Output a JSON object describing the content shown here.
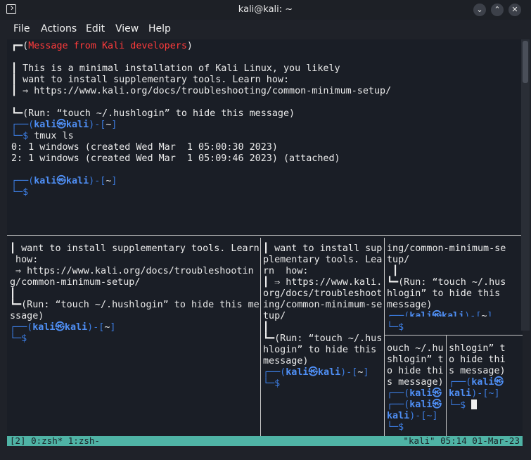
{
  "window": {
    "title": "kali@kali: ~",
    "buttons": [
      "⌄",
      "⌃",
      "✕"
    ]
  },
  "menu": [
    "File",
    "Actions",
    "Edit",
    "View",
    "Help"
  ],
  "main_pane": {
    "banner": {
      "header_prefix": "┏━(",
      "header_text": "Message from Kali developers",
      "header_suffix": ")",
      "line1": "┃ This is a minimal installation of Kali Linux, you likely",
      "line2": "┃ want to install supplementary tools. Learn how:",
      "line3": "┃ ⇒ https://www.kali.org/docs/troubleshooting/common-minimum-setup/",
      "footer": "┗━(Run: “touch ~/.hushlogin” to hide this message)"
    },
    "prompt_top_a": "┌──(",
    "prompt_user": "kali㉿kali",
    "prompt_top_b": ")-[",
    "prompt_dir": "~",
    "prompt_top_c": "]",
    "prompt_bottom": "└─$",
    "command": "tmux ls",
    "output1": "0: 1 windows (created Wed Mar  1 05:00:30 2023)",
    "output2": "2: 1 windows (created Wed Mar  1 05:09:46 2023) (attached)"
  },
  "pane_left": {
    "lines": [
      "┃ want to install supplementary tools. Learn",
      " how:",
      " ⇒ https://www.kali.org/docs/troubleshootin",
      "g/common-minimum-setup/",
      "┃",
      "┗━(Run: “touch ~/.hushlogin” to hide this me",
      "ssage)"
    ]
  },
  "pane_mid": {
    "lines": [
      "┃ want to install sup",
      "plementary tools. Lea",
      "rn  how:",
      "┃ ⇒ https://www.kali.",
      "org/docs/troubleshoot",
      "ing/common-minimum-se",
      "tup/",
      "┃",
      "┗━(Run: “touch ~/.hus",
      "hlogin” to hide this",
      "message)"
    ]
  },
  "pane_rt": {
    "lines": [
      "ing/common-minimum-se",
      "tup/",
      " ┃",
      "┗━(Run: “touch ~/.hus",
      "hlogin” to hide this",
      "message)"
    ]
  },
  "pane_rb1": {
    "lines": [
      "ouch ~/.hu",
      "shlogin” t",
      "o hide thi",
      "s message)"
    ]
  },
  "pane_rb2": {
    "lines": [
      "shlogin” t",
      "o hide thi",
      "s message)"
    ]
  },
  "prompt_wrap": {
    "pre": "┌──(",
    "user_part": "kali㉿",
    "host_part": "kali",
    "post": ")-[~]"
  },
  "tmux_status": {
    "left": "[2] 0:zsh* 1:zsh-",
    "right": "\"kali\" 05:14 01-Mar-23"
  },
  "colors": {
    "accent": "#4f8ff5",
    "warning": "#ff3b3b",
    "status_bar": "#4fb3a5"
  }
}
